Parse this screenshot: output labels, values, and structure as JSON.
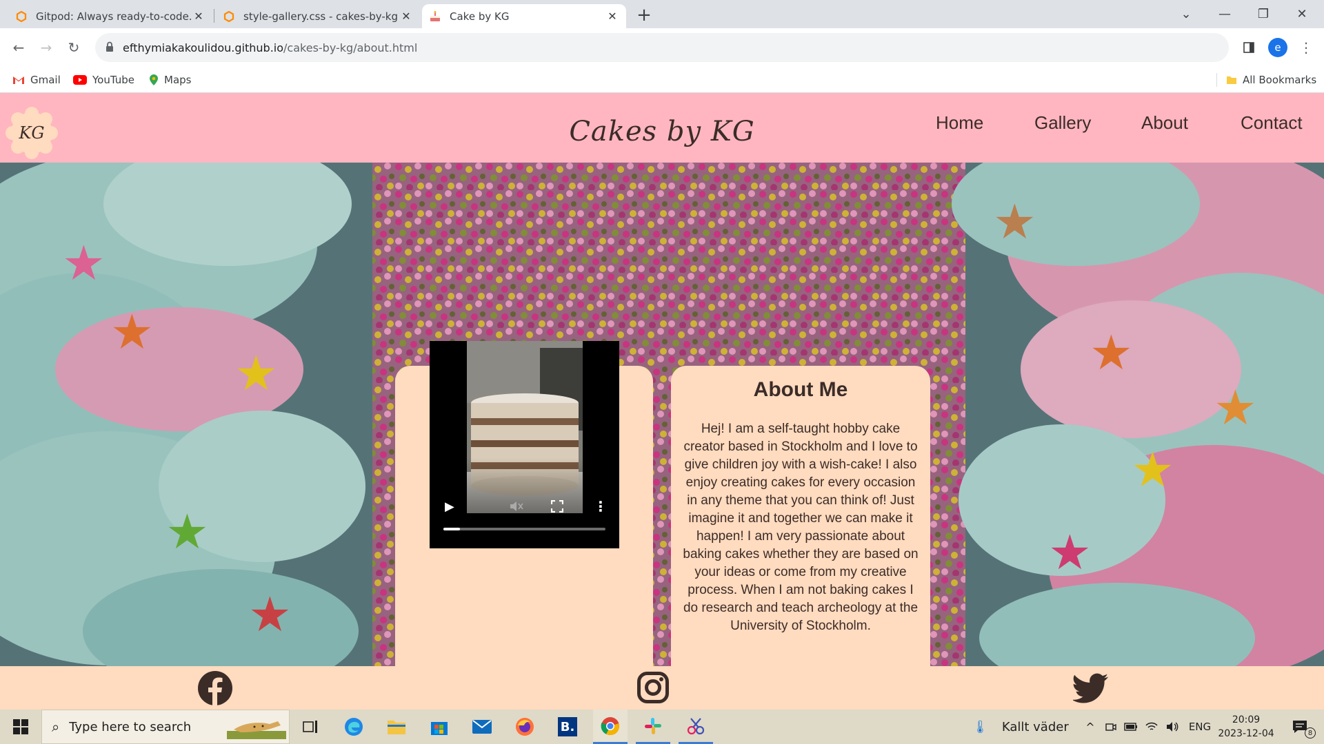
{
  "browser": {
    "tabs": [
      {
        "title": "Gitpod: Always ready-to-code.",
        "icon": "gitpod-icon"
      },
      {
        "title": "style-gallery.css - cakes-by-kg -",
        "icon": "gitpod-icon"
      },
      {
        "title": "Cake by KG",
        "icon": "cake-icon",
        "active": true
      }
    ],
    "url_host": "efthymiakakoulidou.github.io",
    "url_path": "/cakes-by-kg/about.html",
    "profile_initial": "e",
    "bookmarks": [
      {
        "label": "Gmail",
        "icon": "gmail-icon"
      },
      {
        "label": "YouTube",
        "icon": "youtube-icon"
      },
      {
        "label": "Maps",
        "icon": "maps-icon"
      }
    ],
    "all_bookmarks": "All Bookmarks"
  },
  "site": {
    "logo_text": "KG",
    "brand": "Cakes by KG",
    "nav": [
      "Home",
      "Gallery",
      "About",
      "Contact"
    ],
    "about": {
      "title": "About Me",
      "body": "Hej! I am a self-taught hobby cake creator based in Stockholm and I love to give children joy with a wish-cake! I also enjoy creating cakes for every occasion in any theme that you can think of! Just imagine it and together we can make it happen! I am very passionate about baking cakes whether they are based on your ideas or come from my creative process. When I am not baking cakes I do research and teach archeology at the University of Stockholm.",
      "video_progress": 0.1
    },
    "footer_icons": [
      "facebook-icon",
      "instagram-icon",
      "twitter-icon"
    ]
  },
  "taskbar": {
    "search_placeholder": "Type here to search",
    "weather": "Kallt väder",
    "language": "ENG",
    "time": "20:09",
    "date": "2023-12-04",
    "notification_count": "8"
  },
  "colors": {
    "header_pink": "#ffb6c1",
    "card_peach": "#ffdbbf",
    "text_brown": "#3b2c28"
  }
}
